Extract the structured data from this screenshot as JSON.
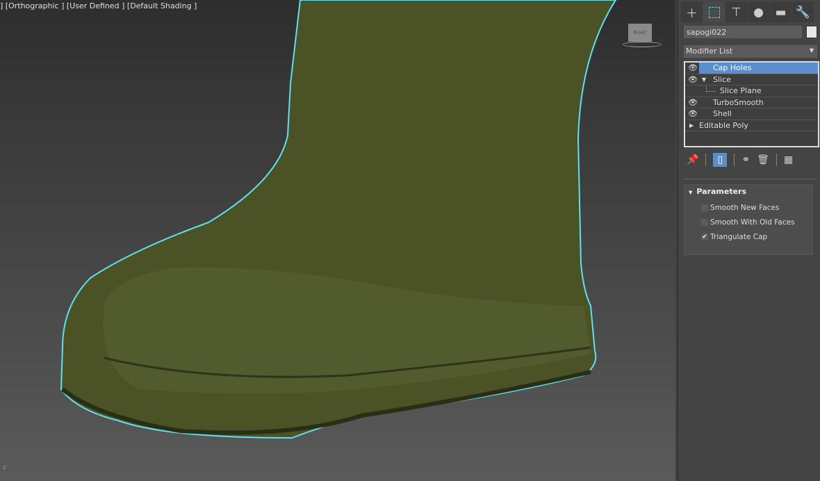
{
  "viewport": {
    "label": "] [Orthographic ] [User Defined ] [Default Shading ]",
    "axis": "z",
    "viewcube_text": "RIGHT"
  },
  "command_panel": {
    "tabs": [
      {
        "icon": "create-icon"
      },
      {
        "icon": "modify-icon"
      },
      {
        "icon": "hierarchy-icon"
      },
      {
        "icon": "motion-icon"
      },
      {
        "icon": "display-icon"
      },
      {
        "icon": "utilities-icon"
      }
    ],
    "object_name": "sapogi022",
    "object_color": "#e6e6e6",
    "modifier_list": "Modifier List",
    "stack": [
      {
        "label": "Cap Holes",
        "eye": true,
        "selected": true
      },
      {
        "label": "Slice",
        "eye": true,
        "expanded": true
      },
      {
        "label": "Slice Plane",
        "sub": true
      },
      {
        "label": "TurboSmooth",
        "eye": true
      },
      {
        "label": "Shell",
        "eye": true
      },
      {
        "label": "Editable Poly",
        "collapsed": true
      }
    ],
    "parameters": {
      "title": "Parameters",
      "options": [
        {
          "label": "Smooth New Faces",
          "checked": false
        },
        {
          "label": "Smooth With Old Faces",
          "checked": false
        },
        {
          "label": "Triangulate Cap",
          "checked": true
        }
      ]
    }
  },
  "colors": {
    "selection_outline": "#5fe0f0",
    "boot": "#4b5326",
    "selected": "#5b8ecc"
  }
}
